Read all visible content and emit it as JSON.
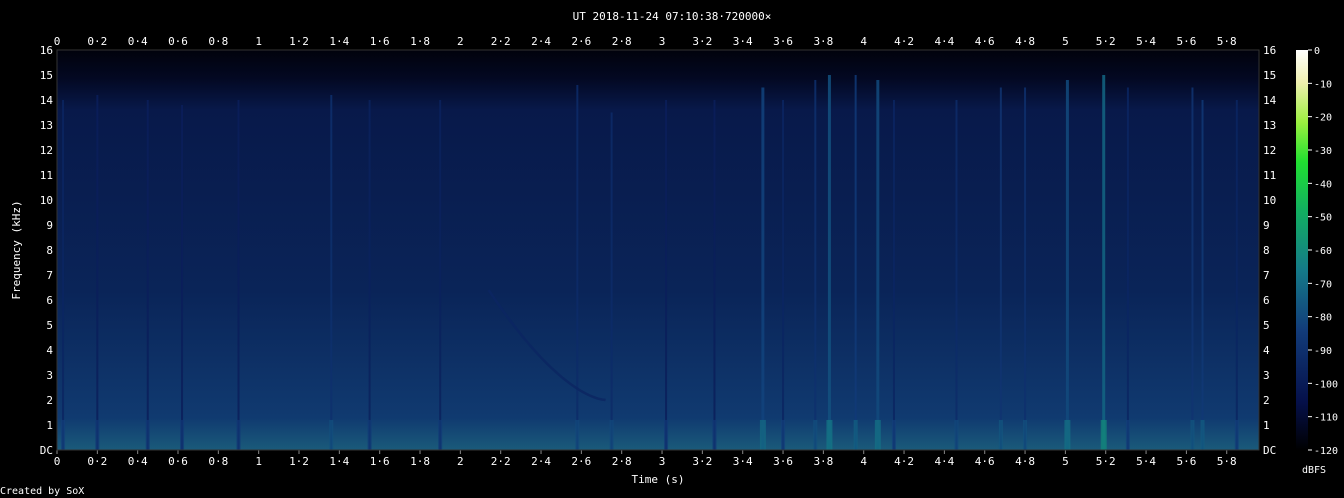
{
  "chart_data": {
    "type": "heatmap",
    "title": "UT 2018-11-24 07:10:38·720000×",
    "xlabel": "Time (s)",
    "ylabel": "Frequency (kHz)",
    "xlim": [
      0,
      5.96
    ],
    "ylim": [
      0,
      16
    ],
    "x_ticks": [
      "0",
      "0·2",
      "0·4",
      "0·6",
      "0·8",
      "1",
      "1·2",
      "1·4",
      "1·6",
      "1·8",
      "2",
      "2·2",
      "2·4",
      "2·6",
      "2·8",
      "3",
      "3·2",
      "3·4",
      "3·6",
      "3·8",
      "4",
      "4·2",
      "4·4",
      "4·6",
      "4·8",
      "5",
      "5·2",
      "5·4",
      "5·6",
      "5·8"
    ],
    "y_ticks": [
      "DC",
      "1",
      "2",
      "3",
      "4",
      "5",
      "6",
      "7",
      "8",
      "9",
      "10",
      "11",
      "12",
      "13",
      "14",
      "15",
      "16"
    ],
    "colorbar": {
      "label": "dBFS",
      "range": [
        -120,
        0
      ],
      "ticks": [
        "0",
        "-10",
        "-20",
        "-30",
        "-40",
        "-50",
        "-60",
        "-70",
        "-80",
        "-90",
        "-100",
        "-110",
        "-120"
      ]
    },
    "colors": {
      "background": "#000000",
      "noise": "#0a1a4a",
      "mid": "#1c6e8c",
      "high": "#20d060"
    },
    "vertical_bursts_s": [
      {
        "t": 0.03,
        "top_khz": 14.0,
        "db": -95
      },
      {
        "t": 0.2,
        "top_khz": 14.2,
        "db": -98
      },
      {
        "t": 0.45,
        "top_khz": 14.0,
        "db": -98
      },
      {
        "t": 0.62,
        "top_khz": 13.8,
        "db": -98
      },
      {
        "t": 0.9,
        "top_khz": 14.0,
        "db": -98
      },
      {
        "t": 1.36,
        "top_khz": 14.2,
        "db": -90
      },
      {
        "t": 1.55,
        "top_khz": 14.0,
        "db": -97
      },
      {
        "t": 1.9,
        "top_khz": 14.0,
        "db": -97
      },
      {
        "t": 2.58,
        "top_khz": 14.6,
        "db": -92
      },
      {
        "t": 2.75,
        "top_khz": 13.5,
        "db": -92
      },
      {
        "t": 3.02,
        "top_khz": 14.0,
        "db": -98
      },
      {
        "t": 3.26,
        "top_khz": 14.0,
        "db": -98
      },
      {
        "t": 3.5,
        "top_khz": 14.5,
        "db": -82
      },
      {
        "t": 3.6,
        "top_khz": 14.0,
        "db": -95
      },
      {
        "t": 3.76,
        "top_khz": 14.8,
        "db": -90
      },
      {
        "t": 3.83,
        "top_khz": 15.0,
        "db": -78
      },
      {
        "t": 3.96,
        "top_khz": 15.0,
        "db": -85
      },
      {
        "t": 4.07,
        "top_khz": 14.8,
        "db": -80
      },
      {
        "t": 4.15,
        "top_khz": 14.0,
        "db": -95
      },
      {
        "t": 4.46,
        "top_khz": 14.0,
        "db": -92
      },
      {
        "t": 4.68,
        "top_khz": 14.5,
        "db": -88
      },
      {
        "t": 4.8,
        "top_khz": 14.5,
        "db": -90
      },
      {
        "t": 5.01,
        "top_khz": 14.8,
        "db": -80
      },
      {
        "t": 5.19,
        "top_khz": 15.0,
        "db": -72
      },
      {
        "t": 5.31,
        "top_khz": 14.5,
        "db": -95
      },
      {
        "t": 5.63,
        "top_khz": 14.5,
        "db": -88
      },
      {
        "t": 5.68,
        "top_khz": 14.0,
        "db": -86
      },
      {
        "t": 5.85,
        "top_khz": 14.0,
        "db": -95
      }
    ],
    "whistler": {
      "t_start": 2.14,
      "t_end": 2.72,
      "f_start_khz": 6.4,
      "f_end_khz": 2.0,
      "db": -95
    }
  },
  "footer": {
    "credit": "Created by SoX"
  }
}
